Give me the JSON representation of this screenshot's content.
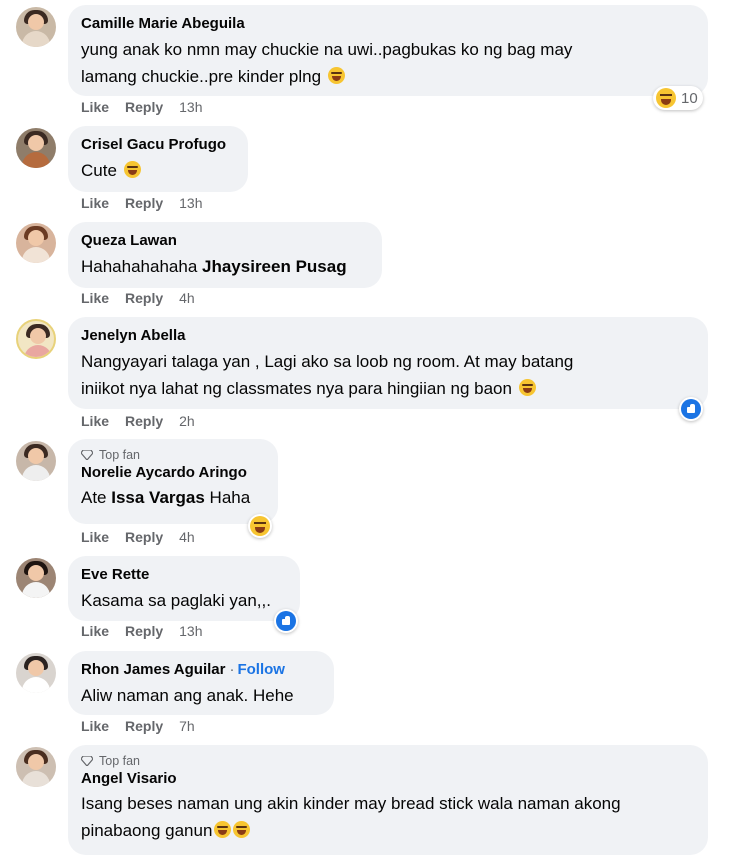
{
  "colors": {
    "bubble": "#f0f2f5",
    "meta": "#65676b",
    "link": "#1b74e4",
    "haha": "#f7c531",
    "like": "#1b74e4"
  },
  "comments": [
    {
      "name": "Camille Marie Abeguila",
      "line1": "yung anak ko nmn may chuckie na uwi..pagbukas ko ng bag may",
      "line2": "lamang chuckie..pre kinder plng",
      "emoji_after": "rofl-emoji",
      "like": "Like",
      "reply": "Reply",
      "time": "13h",
      "reaction_type": "haha",
      "reaction_count": "10"
    },
    {
      "name": "Crisel Gacu Profugo",
      "text": "Cute",
      "emoji_after": "grin-sweat-emoji",
      "like": "Like",
      "reply": "Reply",
      "time": "13h"
    },
    {
      "name": "Queza Lawan",
      "text_plain": "Hahahahahaha ",
      "mention": "Jhaysireen Pusag",
      "like": "Like",
      "reply": "Reply",
      "time": "4h"
    },
    {
      "name": "Jenelyn Abella",
      "line1": "Nangyayari talaga yan , Lagi ako sa loob ng room. At may batang",
      "line2": "iniikot nya lahat ng classmates nya para hingiian ng baon",
      "emoji_after": "joy-emoji",
      "like": "Like",
      "reply": "Reply",
      "time": "2h",
      "reaction_type": "like"
    },
    {
      "badge": "Top fan",
      "name": "Norelie Aycardo Aringo",
      "text_plain": "Ate ",
      "mention": "Issa Vargas",
      "text_after": " Haha",
      "like": "Like",
      "reply": "Reply",
      "time": "4h",
      "reaction_type": "haha"
    },
    {
      "name": "Eve Rette",
      "text": "Kasama sa paglaki yan,,.",
      "like": "Like",
      "reply": "Reply",
      "time": "13h",
      "reaction_type": "like"
    },
    {
      "name": "Rhon James Aguilar",
      "dot": "·",
      "follow": "Follow",
      "text": "Aliw naman ang anak. Hehe",
      "like": "Like",
      "reply": "Reply",
      "time": "7h"
    },
    {
      "badge": "Top fan",
      "name": "Angel Visario",
      "line1": "Isang beses naman ung akin kinder may bread stick wala naman akong",
      "line2": "pinabaong ganun",
      "emoji_after": "rofl-emoji"
    }
  ]
}
